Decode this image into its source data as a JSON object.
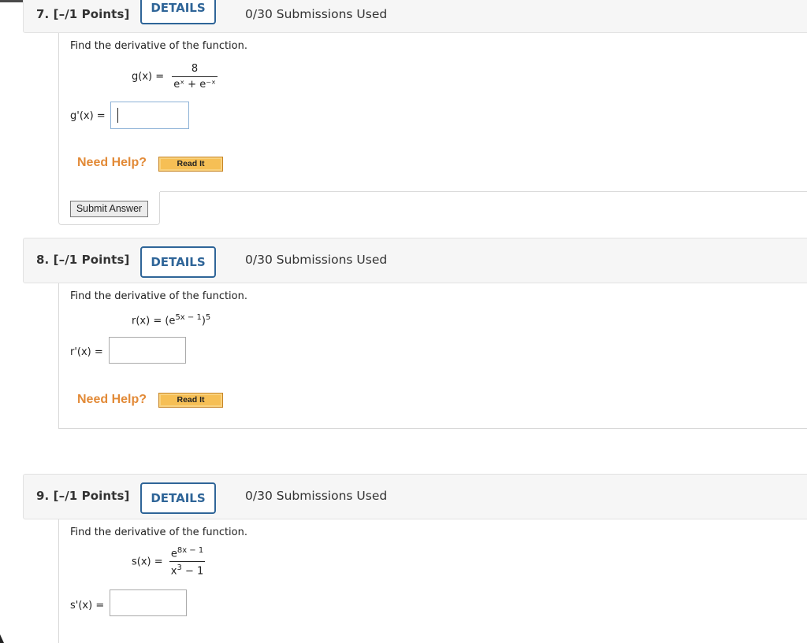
{
  "questions": [
    {
      "number_label": "7. [–/1 Points]",
      "details_label": "DETAILS",
      "submissions": "0/30 Submissions Used",
      "prompt": "Find the derivative of the function.",
      "function_lhs": "g(x) =",
      "function_numerator": "8",
      "function_denominator": "eˣ + e⁻ˣ",
      "answer_label": "g'(x) =",
      "answer_value": "",
      "need_help": "Need Help?",
      "read_it": "Read It",
      "submit_label": "Submit Answer"
    },
    {
      "number_label": "8. [–/1 Points]",
      "details_label": "DETAILS",
      "submissions": "0/30 Submissions Used",
      "prompt": "Find the derivative of the function.",
      "function_lhs": "r(x) =",
      "function_base": "(e",
      "function_exp": "5x − 1",
      "function_close": ")",
      "function_outer_exp": "5",
      "answer_label": "r'(x) =",
      "answer_value": "",
      "need_help": "Need Help?",
      "read_it": "Read It"
    },
    {
      "number_label": "9. [–/1 Points]",
      "details_label": "DETAILS",
      "submissions": "0/30 Submissions Used",
      "prompt": "Find the derivative of the function.",
      "function_lhs": "s(x) =",
      "function_num_base": "e",
      "function_num_exp": "8x − 1",
      "function_den_base": "x",
      "function_den_exp": "3",
      "function_den_tail": " − 1",
      "answer_label": "s'(x) =",
      "answer_value": ""
    }
  ],
  "colors": {
    "details_blue": "#2f6598",
    "need_help_orange": "#e28a37",
    "read_it_fill": "#f6bf55",
    "header_bg": "#f6f6f6"
  }
}
